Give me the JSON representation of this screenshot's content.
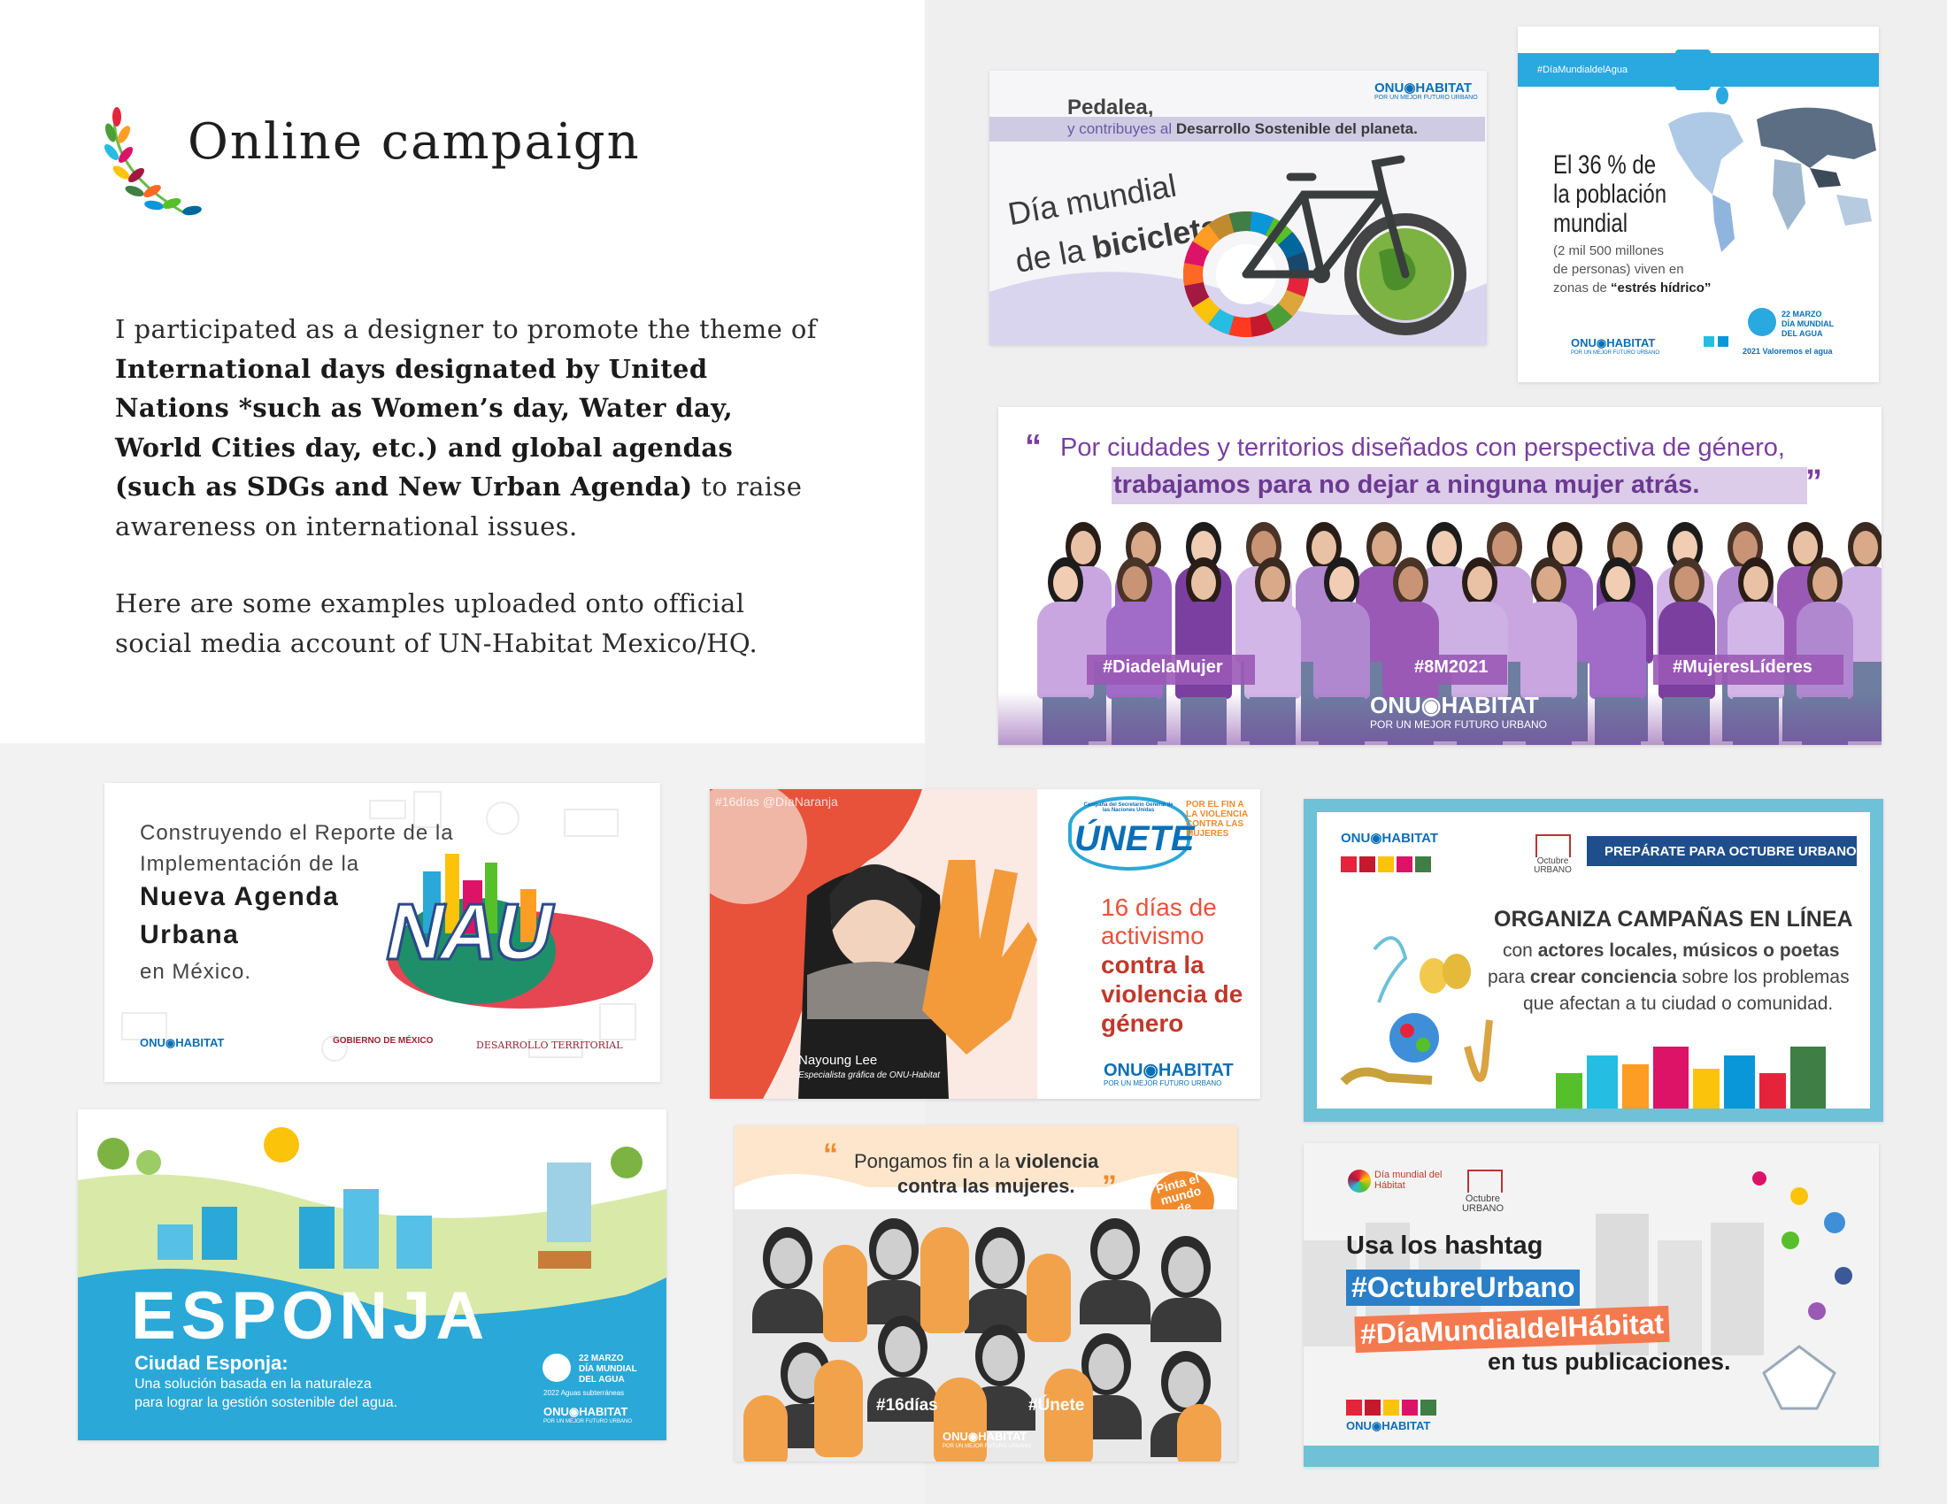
{
  "page": {
    "title": "Online campaign",
    "para1_a": "I participated as a designer to promote the theme of ",
    "para1_b": "International days designated by United Nations *such as Women’s day, Water day, World Cities day, etc.) and global agendas (such as SDGs and New Urban Agenda)",
    "para1_c": " to raise awareness on international issues.",
    "para2": "Here are some examples uploaded onto official social media account of UN-Habitat Mexico/HQ."
  },
  "colors": {
    "purple": "#7b3fa0",
    "lavender": "#c8a8dc",
    "un_blue": "#0b6fb6",
    "orange": "#f08a2c",
    "red_text": "#c0392b",
    "cyan": "#2aa8d8"
  },
  "bike": {
    "line1": "Pedalea,",
    "line2_a": "y contribuyes al ",
    "line2_b": "Desarrollo Sostenible del planeta.",
    "title_a": "Día mundial",
    "title_b": "de la ",
    "title_c": "bicicleta",
    "logo": "ONU◉HABITAT",
    "logo_sub": "POR UN MEJOR FUTURO URBANO"
  },
  "water": {
    "tag": "#DíaMundialdelAgua",
    "stat1": "El 36 % de",
    "stat2": "la población",
    "stat3": "mundial",
    "sub1": "(2 mil 500 millones",
    "sub2": "de personas) viven en",
    "sub3_a": "zonas de ",
    "sub3_b": "“estrés hídrico”",
    "logo": "ONU◉HABITAT",
    "logo_sub": "POR UN MEJOR FUTURO URBANO",
    "day1": "22 MARZO",
    "day2": "DÍA MUNDIAL",
    "day3": "DEL AGUA",
    "day4": "2021 Valoremos el agua"
  },
  "women": {
    "quote1": "Por ciudades y territorios diseñados con perspectiva de género,",
    "quote2": "trabajamos para no dejar a ninguna mujer atrás.",
    "tag1": "#DiadelaMujer",
    "tag2": "#8M2021",
    "tag3": "#MujeresLíderes",
    "logo": "ONU◉HABITAT",
    "logo_sub": "POR UN MEJOR FUTURO URBANO"
  },
  "nau": {
    "l1": "Construyendo el Reporte de la",
    "l2": "Implementación de la",
    "l3": "Nueva Agenda",
    "l4": "Urbana",
    "l5": "en México.",
    "letters": "NAU",
    "logo1": "ONU◉HABITAT",
    "logo2": "GOBIERNO DE MÉXICO",
    "logo3": "DESARROLLO TERRITORIAL"
  },
  "unete": {
    "tag": "#16días @DíaNaranja",
    "brand": "ÚNETE",
    "brand_top": "Campaña del Secretario General de las Naciones Unidas",
    "brand_side": "POR EL FIN A LA VIOLENCIA CONTRA LAS MUJERES",
    "t1": "16 días de",
    "t2": "activismo",
    "t3": "contra la",
    "t4": "violencia de",
    "t5": "género",
    "name": "Nayoung Lee",
    "role": "Especialista gráfica de ONU-Habitat",
    "logo": "ONU◉HABITAT",
    "logo_sub": "POR UN MEJOR FUTURO URBANO"
  },
  "octubre": {
    "logo": "ONU◉HABITAT",
    "badge": "PREPÁRATE PARA OCTUBRE URBANO",
    "brand": "Octubre URBANO",
    "h": "ORGANIZA CAMPAÑAS EN LÍNEA",
    "l1_a": "con ",
    "l1_b": "actores locales, músicos o poetas",
    "l2_a": "para ",
    "l2_b": "crear conciencia",
    "l2_c": " sobre los problemas",
    "l3": "que afectan a tu ciudad o comunidad."
  },
  "esponja": {
    "word": "ESPONJA",
    "h": "Ciudad Esponja:",
    "s1": "Una solución basada en la naturaleza",
    "s2": "para lograr la gestión sostenible del agua.",
    "day1": "22 MARZO",
    "day2": "DÍA MUNDIAL",
    "day3": "DEL AGUA",
    "day4": "2022 Aguas subterráneas",
    "logo": "ONU◉HABITAT",
    "logo_sub": "POR UN MEJOR FUTURO URBANO"
  },
  "naranja": {
    "q1_a": "Pongamos fin a la ",
    "q1_b": "violencia",
    "q2": "contra las mujeres.",
    "stamp": "Pinta el mundo de naranja",
    "tag1": "#16días",
    "tag2": "#Únete",
    "logo": "ONU◉HABITAT",
    "logo_sub": "POR UN MEJOR FUTURO URBANO"
  },
  "hashtag": {
    "brand1": "Día mundial del Hábitat",
    "brand2": "Octubre URBANO",
    "l1": "Usa los hashtag",
    "tag1": "#OctubreUrbano",
    "tag2": "#DíaMundialdelHábitat",
    "l2": "en tus publicaciones.",
    "logo": "ONU◉HABITAT"
  },
  "sdg_colors": [
    "#e5243b",
    "#dda63a",
    "#4c9f38",
    "#c5192d",
    "#ff3a21",
    "#26bde2",
    "#fcc30b",
    "#a21942",
    "#fd6925",
    "#dd1367",
    "#fd9d24",
    "#bf8b2e",
    "#3f7e44",
    "#0a97d9",
    "#56c02b",
    "#00689d",
    "#19486a"
  ]
}
